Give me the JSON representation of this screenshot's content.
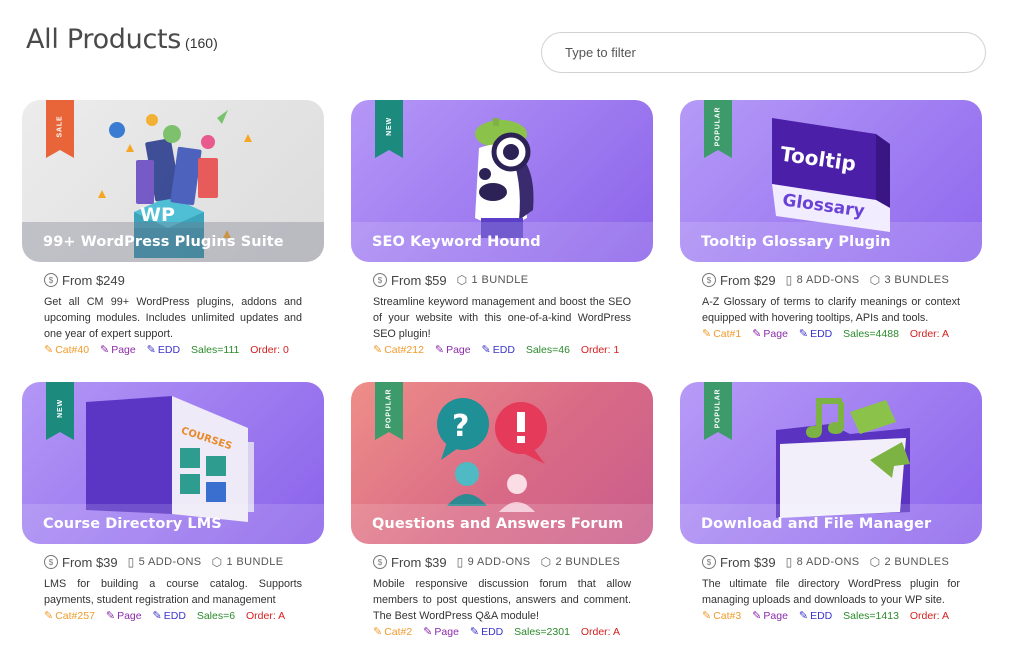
{
  "header": {
    "title": "All Products",
    "count": "(160)"
  },
  "filter": {
    "placeholder": "Type to filter"
  },
  "products": [
    {
      "title": "99+ WordPress Plugins Suite",
      "ribbon": "SALE",
      "ribbon_color": "#e8653a",
      "price": "From $249",
      "addons": "",
      "bundles": "",
      "description": "Get all CM 99+ WordPress plugins, addons and upcoming modules. Includes unlimited updates and one year of expert support.",
      "cat": "Cat#40",
      "page": "Page",
      "edd": "EDD",
      "sales": "Sales=111",
      "order": "Order: 0"
    },
    {
      "title": "SEO Keyword Hound",
      "ribbon": "NEW",
      "ribbon_color": "#1d8a7e",
      "price": "From $59",
      "addons": "",
      "bundles": "1 BUNDLE",
      "description": "Streamline keyword management and boost the SEO of your website with this one-of-a-kind WordPress SEO plugin!",
      "cat": "Cat#212",
      "page": "Page",
      "edd": "EDD",
      "sales": "Sales=46",
      "order": "Order: 1"
    },
    {
      "title": "Tooltip Glossary Plugin",
      "ribbon": "POPULAR",
      "ribbon_color": "#3d9a6b",
      "price": "From $29",
      "addons": "8 ADD-ONS",
      "bundles": "3 BUNDLES",
      "description": "A-Z Glossary of terms to clarify meanings or context equipped with hovering tooltips, APIs and tools.",
      "cat": "Cat#1",
      "page": "Page",
      "edd": "EDD",
      "sales": "Sales=4488",
      "order": "Order: A"
    },
    {
      "title": "Course Directory LMS",
      "ribbon": "NEW",
      "ribbon_color": "#1d8a7e",
      "price": "From $39",
      "addons": "5 ADD-ONS",
      "bundles": "1 BUNDLE",
      "description": "LMS for building a course catalog. Supports payments, student registration and management",
      "cat": "Cat#257",
      "page": "Page",
      "edd": "EDD",
      "sales": "Sales=6",
      "order": "Order: A"
    },
    {
      "title": "Questions and Answers Forum",
      "ribbon": "POPULAR",
      "ribbon_color": "#3d9a6b",
      "price": "From $39",
      "addons": "9 ADD-ONS",
      "bundles": "2 BUNDLES",
      "description": "Mobile responsive discussion forum that allow members to post questions, answers and comment. The Best WordPress Q&A module!",
      "cat": "Cat#2",
      "page": "Page",
      "edd": "EDD",
      "sales": "Sales=2301",
      "order": "Order: A"
    },
    {
      "title": "Download and File Manager",
      "ribbon": "POPULAR",
      "ribbon_color": "#3d9a6b",
      "price": "From $39",
      "addons": "8 ADD-ONS",
      "bundles": "2 BUNDLES",
      "description": "The ultimate file directory WordPress plugin for managing uploads and downloads to your WP site.",
      "cat": "Cat#3",
      "page": "Page",
      "edd": "EDD",
      "sales": "Sales=1413",
      "order": "Order: A"
    }
  ],
  "icons": {
    "price": "dollar-coin-icon",
    "addons": "page-icon",
    "bundles": "box-icon",
    "edit": "pencil-icon"
  },
  "colors": {
    "cat": "#f09b2c",
    "page": "#8b2ca8",
    "edd": "#3b34c9",
    "sales": "#2a8a2a",
    "order": "#d42020"
  }
}
